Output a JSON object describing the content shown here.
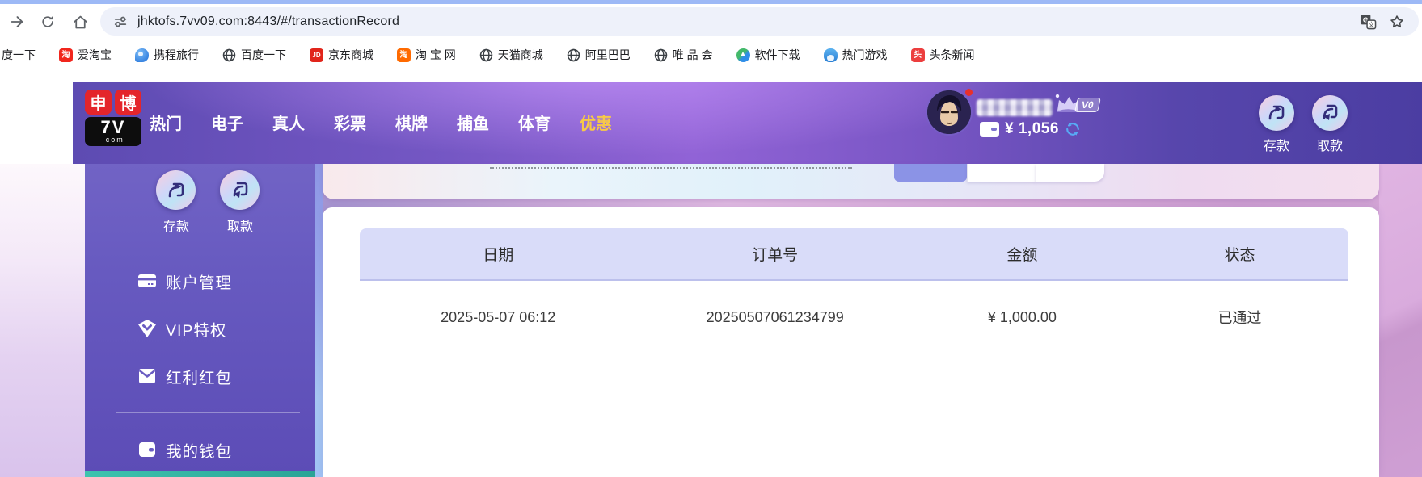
{
  "browser": {
    "url": "jhktofs.7vv09.com:8443/#/transactionRecord",
    "partial_bookmark_label": "度一下",
    "bookmarks": [
      {
        "label": "爱淘宝",
        "icon": "taobao-red-icon",
        "glyph": "淘"
      },
      {
        "label": "携程旅行",
        "icon": "ctrip-icon"
      },
      {
        "label": "百度一下",
        "icon": "globe-icon"
      },
      {
        "label": "京东商城",
        "icon": "jd-icon",
        "glyph": "JD"
      },
      {
        "label": "淘 宝 网",
        "icon": "taobao-orange-icon",
        "glyph": "淘"
      },
      {
        "label": "天猫商城",
        "icon": "globe-icon"
      },
      {
        "label": "阿里巴巴",
        "icon": "globe-icon"
      },
      {
        "label": "唯 品 会",
        "icon": "globe-icon"
      },
      {
        "label": "软件下载",
        "icon": "software-icon"
      },
      {
        "label": "热门游戏",
        "icon": "game-icon"
      },
      {
        "label": "头条新闻",
        "icon": "toutiao-icon",
        "glyph": "头"
      }
    ]
  },
  "header": {
    "logo": {
      "badge_left": "申",
      "badge_right": "博",
      "name": "7V",
      "suffix": ".com"
    },
    "nav": [
      {
        "label": "热门"
      },
      {
        "label": "电子"
      },
      {
        "label": "真人"
      },
      {
        "label": "彩票"
      },
      {
        "label": "棋牌"
      },
      {
        "label": "捕鱼"
      },
      {
        "label": "体育"
      },
      {
        "label": "优惠"
      }
    ],
    "user": {
      "vip_badge": "V0",
      "balance": "¥ 1,056"
    },
    "deposit_label": "存款",
    "withdraw_label": "取款"
  },
  "sidebar": {
    "deposit_label": "存款",
    "withdraw_label": "取款",
    "items": [
      {
        "label": "账户管理",
        "icon": "bank-card-icon"
      },
      {
        "label": "VIP特权",
        "icon": "vip-shield-icon"
      },
      {
        "label": "红利红包",
        "icon": "red-packet-icon"
      },
      {
        "label": "我的钱包",
        "icon": "wallet-icon"
      }
    ]
  },
  "main": {
    "table": {
      "columns": [
        "日期",
        "订单号",
        "金额",
        "状态"
      ],
      "rows": [
        [
          "2025-05-07 06:12",
          "20250507061234799",
          "¥ 1,000.00",
          "已通过"
        ]
      ]
    }
  },
  "colors": {
    "header_purple": "#7b57c6",
    "accent_yellow": "#f7c948",
    "teal_bar": "#2fb3a1",
    "table_header_lavender": "#d9dcf9"
  }
}
